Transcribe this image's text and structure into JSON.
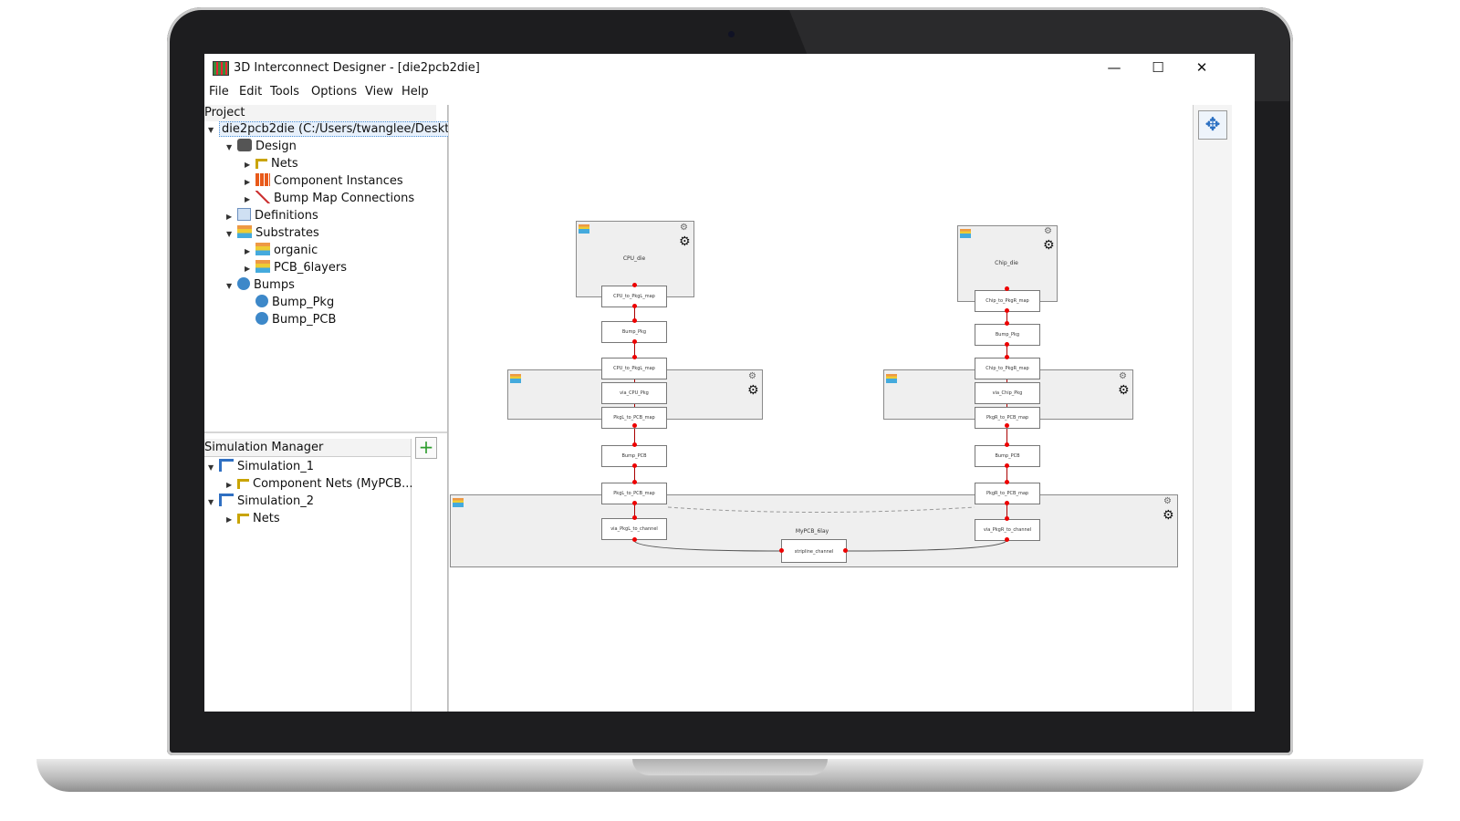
{
  "window": {
    "title": "3D Interconnect Designer - [die2pcb2die]",
    "min_glyph": "—",
    "max_glyph": "☐",
    "close_glyph": "✕"
  },
  "menu": [
    "File",
    "Edit",
    "Tools",
    "Options",
    "View",
    "Help"
  ],
  "project_panel": {
    "header": "Project",
    "root": "die2pcb2die (C:/Users/twanglee/Deskto...",
    "items": [
      "Design",
      "Nets",
      "Component Instances",
      "Bump Map Connections",
      "Definitions",
      "Substrates",
      "organic",
      "PCB_6layers",
      "Bumps",
      "Bump_Pkg",
      "Bump_PCB"
    ]
  },
  "simulation_panel": {
    "header": "Simulation Manager",
    "add_glyph": "+",
    "items": [
      "Simulation_1",
      "Component Nets (MyPCB...",
      "Simulation_2",
      "Nets"
    ]
  },
  "diagram": {
    "left_die": "CPU_die",
    "right_die": "Chip_die",
    "pcb_label": "MyPCB_6lay",
    "left_nodes": [
      "CPU_to_PkgL_map",
      "Bump_Pkg",
      "CPU_to_PkgL_map",
      "via_CPU_Pkg",
      "PkgL_to_PCB_map",
      "Bump_PCB",
      "PkgL_to_PCB_map",
      "via_PkgL_to_channel"
    ],
    "right_nodes": [
      "Chip_to_PkgR_map",
      "Bump_Pkg",
      "Chip_to_PkgR_map",
      "via_Chip_Pkg",
      "PkgR_to_PCB_map",
      "Bump_PCB",
      "PkgR_to_PCB_map",
      "via_PkgR_to_channel"
    ],
    "channel_node": "stripline_channel"
  },
  "colors": {
    "accent_green": "#2e9d2e",
    "wire_red": "#e00000",
    "block_fill": "#efefef"
  }
}
